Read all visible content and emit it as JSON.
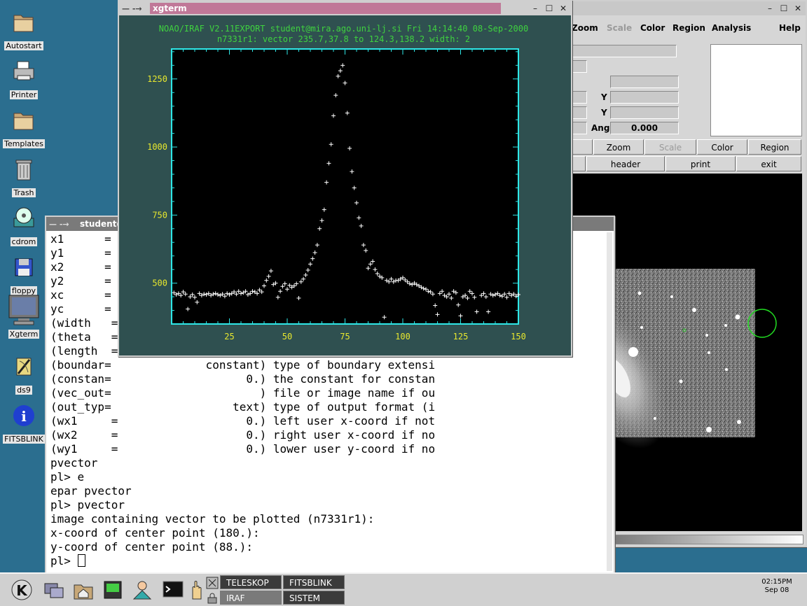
{
  "desktop": {
    "icons": [
      {
        "label": "Autostart",
        "icon": "folder-icon"
      },
      {
        "label": "Printer",
        "icon": "printer-icon"
      },
      {
        "label": "Templates",
        "icon": "folder-icon"
      },
      {
        "label": "Trash",
        "icon": "trash-icon"
      },
      {
        "label": "cdrom",
        "icon": "cdrom-icon"
      },
      {
        "label": "floppy",
        "icon": "floppy-icon"
      },
      {
        "label": "Xgterm",
        "icon": "monitor-icon"
      },
      {
        "label": "ds9",
        "icon": "ds9-icon"
      },
      {
        "label": "FITSBLINK",
        "icon": "info-icon"
      }
    ]
  },
  "xgterm_window": {
    "title": "xgterm",
    "menu_glyph": "— -→",
    "header_line1": "NOAO/IRAF V2.11EXPORT student@mira.ago.uni-lj.si Fri 14:14:40 08-Sep-2000",
    "header_line2": "n7331r1: vector 235.7,37.8 to 124.3,138.2 width: 2"
  },
  "chart_data": {
    "type": "scatter",
    "marker": "+",
    "xlim": [
      0,
      150
    ],
    "ylim": [
      350,
      1360
    ],
    "x_ticks": [
      "25",
      "50",
      "75",
      "100",
      "125",
      "150"
    ],
    "y_ticks": [
      "500",
      "750",
      "1000",
      "1250"
    ],
    "x_tick_values": [
      25,
      50,
      75,
      100,
      125,
      150
    ],
    "y_tick_values": [
      500,
      750,
      1000,
      1250
    ],
    "points": [
      [
        1,
        465
      ],
      [
        2,
        458
      ],
      [
        3,
        462
      ],
      [
        4,
        455
      ],
      [
        5,
        468
      ],
      [
        6,
        460
      ],
      [
        7,
        405
      ],
      [
        8,
        450
      ],
      [
        9,
        458
      ],
      [
        10,
        448
      ],
      [
        11,
        430
      ],
      [
        12,
        462
      ],
      [
        13,
        455
      ],
      [
        14,
        460
      ],
      [
        15,
        458
      ],
      [
        16,
        462
      ],
      [
        17,
        455
      ],
      [
        18,
        460
      ],
      [
        19,
        462
      ],
      [
        20,
        458
      ],
      [
        21,
        455
      ],
      [
        22,
        460
      ],
      [
        23,
        452
      ],
      [
        24,
        462
      ],
      [
        25,
        458
      ],
      [
        26,
        462
      ],
      [
        27,
        468
      ],
      [
        28,
        460
      ],
      [
        29,
        470
      ],
      [
        30,
        462
      ],
      [
        31,
        465
      ],
      [
        32,
        470
      ],
      [
        33,
        458
      ],
      [
        34,
        462
      ],
      [
        35,
        470
      ],
      [
        36,
        468
      ],
      [
        37,
        462
      ],
      [
        38,
        475
      ],
      [
        39,
        468
      ],
      [
        40,
        490
      ],
      [
        41,
        510
      ],
      [
        42,
        525
      ],
      [
        43,
        545
      ],
      [
        44,
        495
      ],
      [
        45,
        500
      ],
      [
        46,
        448
      ],
      [
        47,
        470
      ],
      [
        48,
        488
      ],
      [
        49,
        498
      ],
      [
        50,
        478
      ],
      [
        51,
        492
      ],
      [
        52,
        485
      ],
      [
        53,
        490
      ],
      [
        54,
        498
      ],
      [
        55,
        445
      ],
      [
        56,
        505
      ],
      [
        57,
        515
      ],
      [
        58,
        530
      ],
      [
        59,
        548
      ],
      [
        60,
        570
      ],
      [
        61,
        590
      ],
      [
        62,
        612
      ],
      [
        63,
        640
      ],
      [
        64,
        700
      ],
      [
        65,
        730
      ],
      [
        66,
        770
      ],
      [
        67,
        870
      ],
      [
        68,
        940
      ],
      [
        69,
        1010
      ],
      [
        70,
        1115
      ],
      [
        71,
        1190
      ],
      [
        72,
        1260
      ],
      [
        73,
        1280
      ],
      [
        74,
        1300
      ],
      [
        75,
        1235
      ],
      [
        76,
        1125
      ],
      [
        77,
        995
      ],
      [
        78,
        910
      ],
      [
        79,
        850
      ],
      [
        80,
        795
      ],
      [
        81,
        740
      ],
      [
        82,
        710
      ],
      [
        83,
        640
      ],
      [
        84,
        620
      ],
      [
        85,
        555
      ],
      [
        86,
        570
      ],
      [
        87,
        580
      ],
      [
        88,
        550
      ],
      [
        89,
        535
      ],
      [
        90,
        525
      ],
      [
        91,
        520
      ],
      [
        92,
        375
      ],
      [
        93,
        510
      ],
      [
        94,
        505
      ],
      [
        95,
        515
      ],
      [
        96,
        505
      ],
      [
        97,
        510
      ],
      [
        98,
        510
      ],
      [
        99,
        515
      ],
      [
        100,
        520
      ],
      [
        101,
        512
      ],
      [
        102,
        505
      ],
      [
        103,
        498
      ],
      [
        104,
        495
      ],
      [
        105,
        500
      ],
      [
        106,
        495
      ],
      [
        107,
        490
      ],
      [
        108,
        485
      ],
      [
        109,
        480
      ],
      [
        110,
        478
      ],
      [
        111,
        470
      ],
      [
        112,
        468
      ],
      [
        113,
        460
      ],
      [
        114,
        418
      ],
      [
        115,
        385
      ],
      [
        116,
        462
      ],
      [
        117,
        470
      ],
      [
        118,
        455
      ],
      [
        119,
        450
      ],
      [
        120,
        460
      ],
      [
        121,
        445
      ],
      [
        122,
        470
      ],
      [
        123,
        465
      ],
      [
        124,
        420
      ],
      [
        125,
        380
      ],
      [
        126,
        450
      ],
      [
        127,
        455
      ],
      [
        128,
        445
      ],
      [
        129,
        470
      ],
      [
        130,
        462
      ],
      [
        131,
        448
      ],
      [
        132,
        395
      ],
      [
        133,
        340
      ],
      [
        134,
        455
      ],
      [
        135,
        462
      ],
      [
        136,
        450
      ],
      [
        137,
        395
      ],
      [
        138,
        460
      ],
      [
        139,
        455
      ],
      [
        140,
        458
      ],
      [
        141,
        462
      ],
      [
        142,
        455
      ],
      [
        143,
        452
      ],
      [
        144,
        460
      ],
      [
        145,
        448
      ],
      [
        146,
        462
      ],
      [
        147,
        455
      ],
      [
        148,
        460
      ],
      [
        149,
        452
      ],
      [
        150,
        458
      ]
    ]
  },
  "terminal_window": {
    "title": "student@",
    "menu_glyph": "— -→",
    "lines": [
      "x1      =",
      "y1      =",
      "x2      =",
      "y2      =",
      "xc      =",
      "yc      =",
      "(width   =",
      "(theta   =",
      "(length  =",
      "(boundar=              constant) type of boundary extensi",
      "(constan=                    0.) the constant for constan",
      "(vec_out=                      ) file or image name if ou",
      "(out_typ=                  text) type of output format (i",
      "(wx1     =                   0.) left user x-coord if not",
      "(wx2     =                   0.) right user x-coord if no",
      "(wy1     =                   0.) lower user y-coord if no",
      "pvector",
      "pl> e",
      "epar pvector",
      "pl> pvector",
      "image containing vector to be plotted (n7331r1):",
      "x-coord of center point (180.):",
      "y-coord of center point (88.):",
      "pl> "
    ]
  },
  "ds9_window": {
    "menu": [
      "Zoom",
      "Scale",
      "Color",
      "Region",
      "Analysis",
      "Help"
    ],
    "labels": {
      "y1": "Y",
      "y2": "Y",
      "ang": "Ang",
      "ang_value": "0.000"
    },
    "buttons_row1": [
      "Zoom",
      "Scale",
      "Color",
      "Region"
    ],
    "buttons_row2": [
      "header",
      "print",
      "exit"
    ]
  },
  "taskbar": {
    "tasks": [
      "TELESKOP",
      "FITSBLINK",
      "IRAF",
      "SISTEM"
    ],
    "time": "02:15PM",
    "date": "Sep 08"
  }
}
